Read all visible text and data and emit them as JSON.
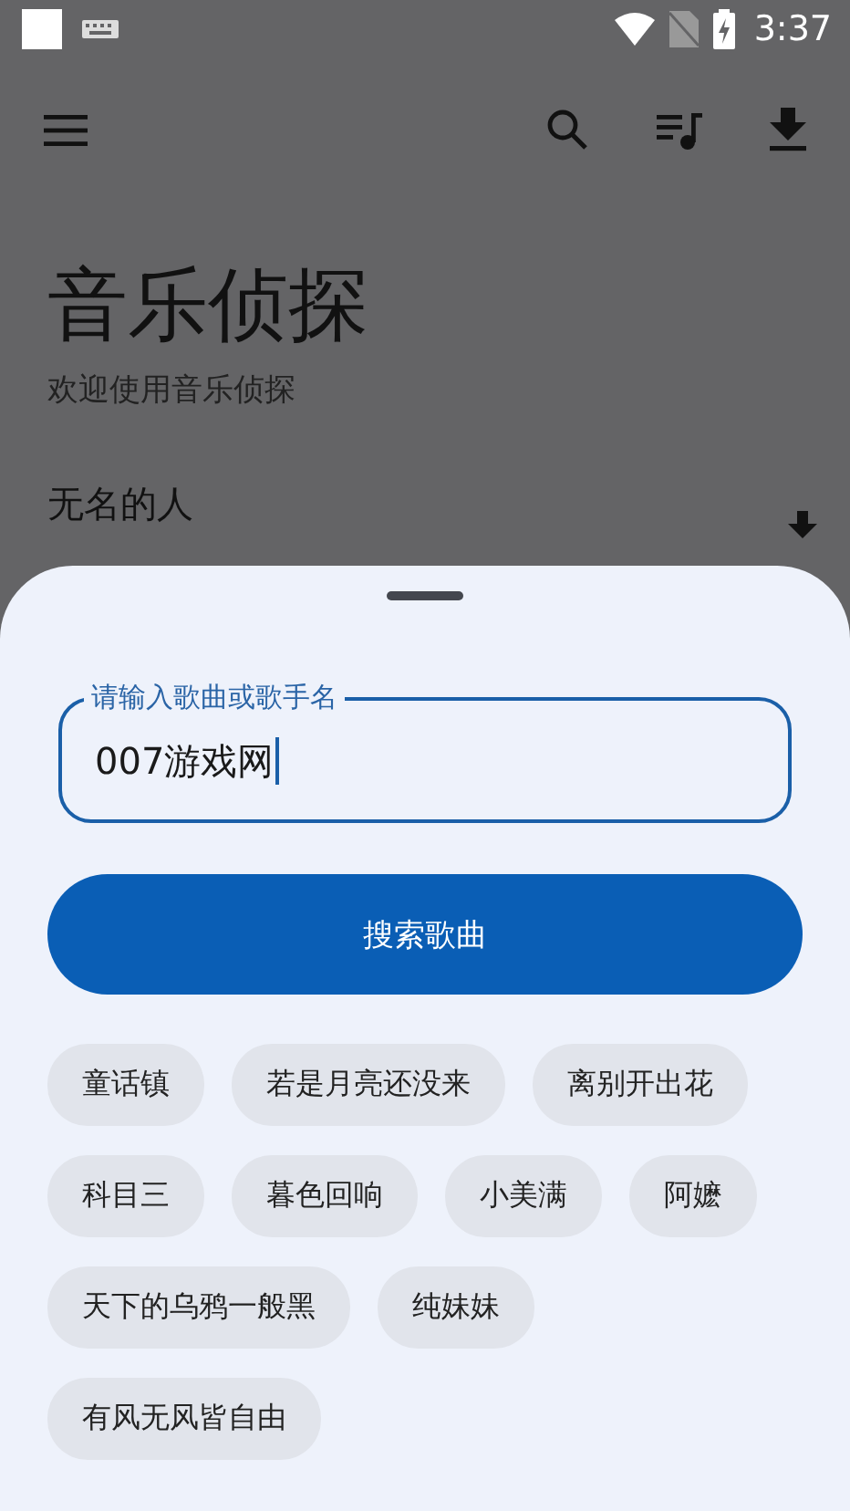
{
  "status_bar": {
    "time": "3:37"
  },
  "header": {
    "title": "音乐侦探",
    "subtitle": "欢迎使用音乐侦探"
  },
  "songs": [
    {
      "title": "无名的人"
    }
  ],
  "search_sheet": {
    "field": {
      "label": "请输入歌曲或歌手名",
      "value": "007游戏网"
    },
    "search_button": "搜索歌曲",
    "suggestions": [
      "童话镇",
      "若是月亮还没来",
      "离别开出花",
      "科目三",
      "暮色回响",
      "小美满",
      "阿嬷",
      "天下的乌鸦一般黑",
      "纯妹妹",
      "有风无风皆自由"
    ]
  }
}
